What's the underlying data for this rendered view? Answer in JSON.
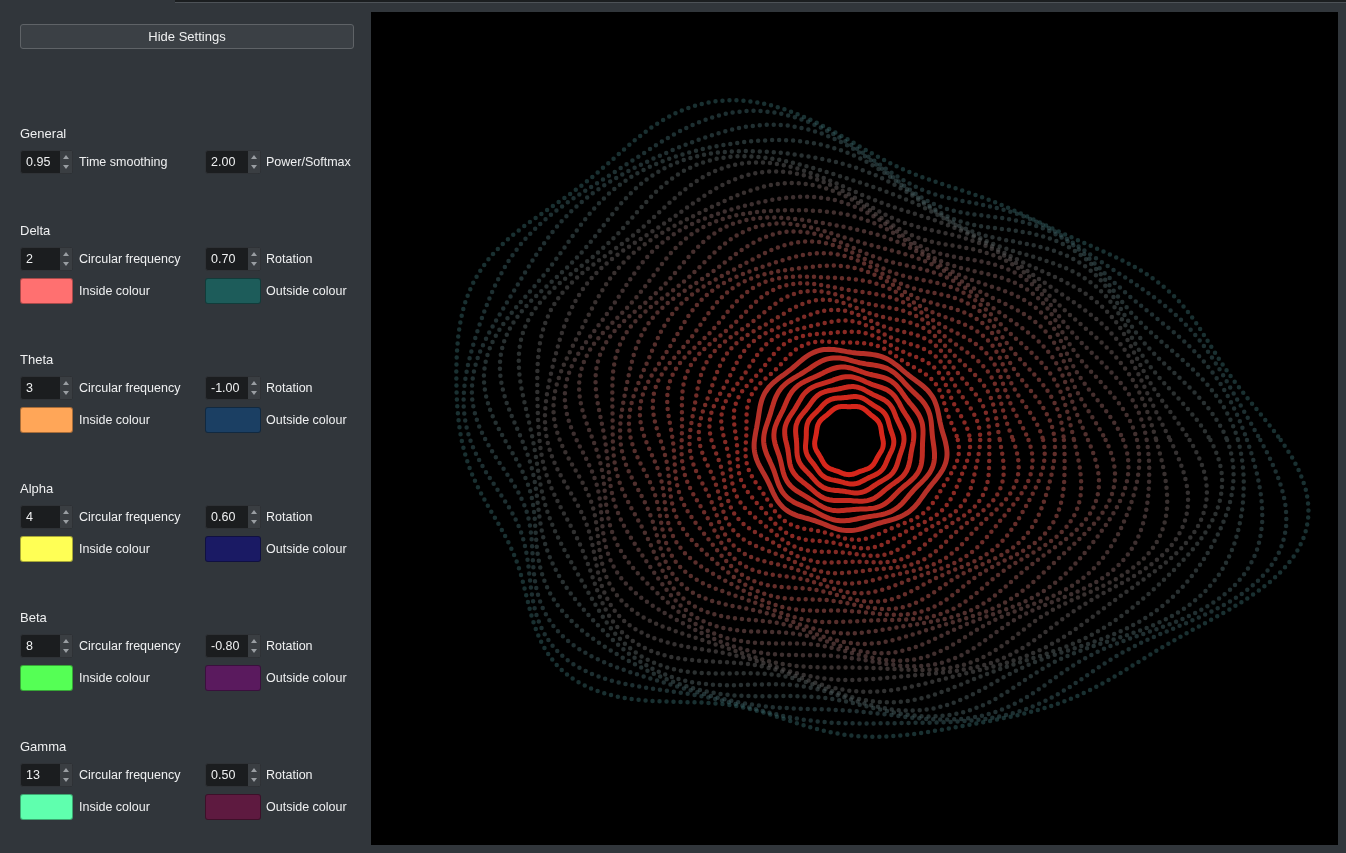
{
  "hide_settings_button": "Hide Settings",
  "sections": [
    {
      "title": "General",
      "spinboxes": [
        {
          "value": "0.95",
          "label": "Time smoothing"
        },
        {
          "value": "2.00",
          "label": "Power/Softmax"
        }
      ]
    },
    {
      "title": "Delta",
      "spinboxes": [
        {
          "value": "2",
          "label": "Circular frequency"
        },
        {
          "value": "0.70",
          "label": "Rotation"
        }
      ],
      "colours": [
        {
          "color": "#ff7070",
          "label": "Inside colour"
        },
        {
          "color": "#1d5c5a",
          "label": "Outside colour"
        }
      ]
    },
    {
      "title": "Theta",
      "spinboxes": [
        {
          "value": "3",
          "label": "Circular frequency"
        },
        {
          "value": "-1.00",
          "label": "Rotation"
        }
      ],
      "colours": [
        {
          "color": "#ffa658",
          "label": "Inside colour"
        },
        {
          "color": "#1b3f63",
          "label": "Outside colour"
        }
      ]
    },
    {
      "title": "Alpha",
      "spinboxes": [
        {
          "value": "4",
          "label": "Circular frequency"
        },
        {
          "value": "0.60",
          "label": "Rotation"
        }
      ],
      "colours": [
        {
          "color": "#ffff55",
          "label": "Inside colour"
        },
        {
          "color": "#1a1a64",
          "label": "Outside colour"
        }
      ]
    },
    {
      "title": "Beta",
      "spinboxes": [
        {
          "value": "8",
          "label": "Circular frequency"
        },
        {
          "value": "-0.80",
          "label": "Rotation"
        }
      ],
      "colours": [
        {
          "color": "#55ff55",
          "label": "Inside colour"
        },
        {
          "color": "#5a1a5e",
          "label": "Outside colour"
        }
      ]
    },
    {
      "title": "Gamma",
      "spinboxes": [
        {
          "value": "13",
          "label": "Circular frequency"
        },
        {
          "value": "0.50",
          "label": "Rotation"
        }
      ],
      "colours": [
        {
          "color": "#5fffae",
          "label": "Inside colour"
        },
        {
          "color": "#5e1a40",
          "label": "Outside colour"
        }
      ]
    }
  ]
}
